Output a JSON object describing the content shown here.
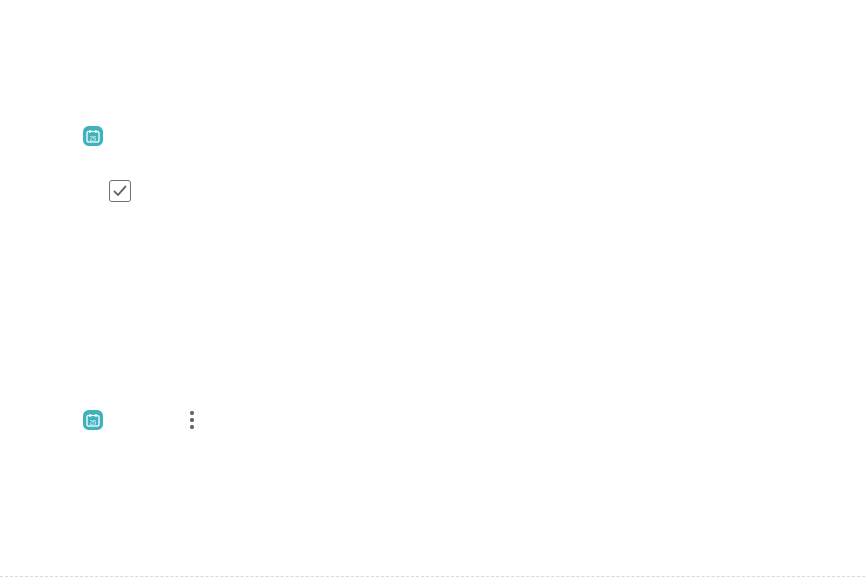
{
  "icons": {
    "calendar_top": {
      "name": "calendar-icon",
      "day": "25",
      "color": "#3db3bb"
    },
    "checkbox": {
      "name": "checkbox-checked-icon",
      "checked": true
    },
    "calendar_bottom": {
      "name": "calendar-icon",
      "day": "25",
      "color": "#3db3bb"
    },
    "more": {
      "name": "more-options-icon"
    }
  }
}
